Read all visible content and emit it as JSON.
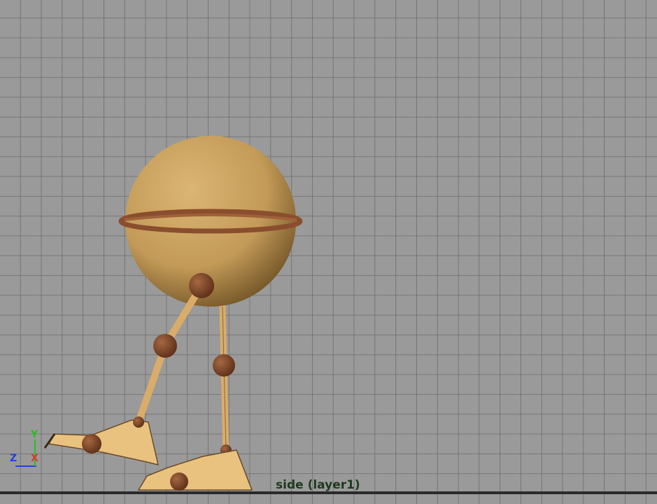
{
  "viewport": {
    "camera_label": "side (layer1)",
    "axes": {
      "y": {
        "label": "Y",
        "color": "#22c022"
      },
      "x": {
        "label": "X",
        "color": "#d83a2a"
      },
      "z": {
        "label": "Z",
        "color": "#2244d8"
      }
    },
    "colors": {
      "background": "#9a9a9a",
      "grid": "#6c6c6c",
      "ground_line": "#2a2a2a",
      "body": "#caa060",
      "joint": "#8a4e2e",
      "limb": "#d9ac6a"
    }
  }
}
